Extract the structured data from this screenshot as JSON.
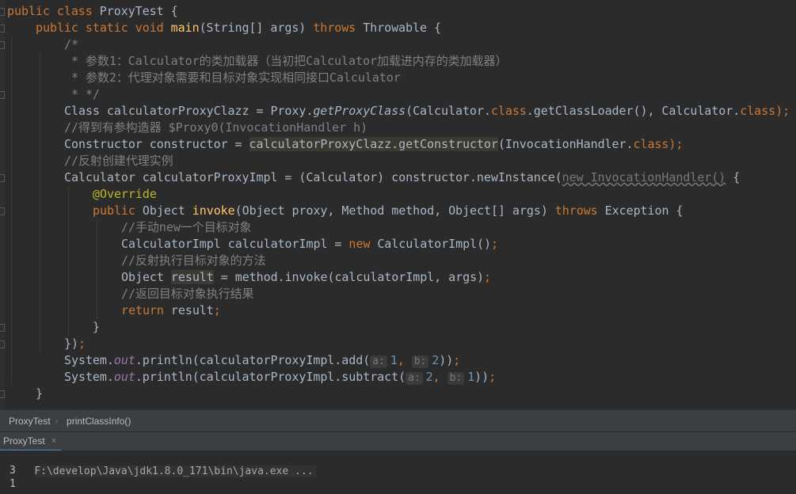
{
  "editor": {
    "lines": [
      {
        "indent": 0,
        "tokens": [
          {
            "t": "public class ",
            "c": "kw"
          },
          {
            "t": "ProxyTest {",
            "c": ""
          }
        ]
      },
      {
        "indent": 1,
        "tokens": [
          {
            "t": "public static void ",
            "c": "kw"
          },
          {
            "t": "main",
            "c": "fn"
          },
          {
            "t": "(String[] args) ",
            "c": ""
          },
          {
            "t": "throws ",
            "c": "kw"
          },
          {
            "t": "Throwable {",
            "c": ""
          }
        ]
      },
      {
        "indent": 2,
        "tokens": [
          {
            "t": "/*",
            "c": "cm"
          }
        ]
      },
      {
        "indent": 2,
        "tokens": [
          {
            "t": " * 参数1：Calculator的类加载器（当初把Calculator加载进内存的类加载器）",
            "c": "cm"
          }
        ]
      },
      {
        "indent": 2,
        "tokens": [
          {
            "t": " * 参数2：代理对象需要和目标对象实现相同接口Calculator",
            "c": "cm"
          }
        ]
      },
      {
        "indent": 2,
        "tokens": [
          {
            "t": " * */",
            "c": "cm"
          }
        ]
      },
      {
        "indent": 2,
        "tokens": [
          {
            "t": "Class calculatorProxyClazz = Proxy.",
            "c": ""
          },
          {
            "t": "getProxyClass",
            "c": "it"
          },
          {
            "t": "(Calculator.",
            "c": ""
          },
          {
            "t": "class",
            "c": "kw"
          },
          {
            "t": ".getClassLoader(), Calculator.",
            "c": ""
          },
          {
            "t": "class",
            "c": "kw"
          },
          {
            "t": ");",
            "c": "kw"
          }
        ]
      },
      {
        "indent": 2,
        "tokens": [
          {
            "t": "//得到有参构造器 $Proxy0(InvocationHandler h)",
            "c": "cm"
          }
        ]
      },
      {
        "indent": 2,
        "tokens": [
          {
            "t": "Constructor constructor = ",
            "c": ""
          },
          {
            "t": "calculatorProxyClazz.getConstructor",
            "c": "hl"
          },
          {
            "t": "(InvocationHandler.",
            "c": ""
          },
          {
            "t": "class",
            "c": "kw"
          },
          {
            "t": ");",
            "c": "kw"
          }
        ]
      },
      {
        "indent": 2,
        "tokens": [
          {
            "t": "//反射创建代理实例",
            "c": "cm"
          }
        ]
      },
      {
        "indent": 2,
        "tokens": [
          {
            "t": "Calculator calculatorProxyImpl = (Calculator) constructor.newInstance(",
            "c": ""
          },
          {
            "t": "new InvocationHandler()",
            "c": "squig"
          },
          {
            "t": " {",
            "c": ""
          }
        ]
      },
      {
        "indent": 3,
        "tokens": [
          {
            "t": "@Override",
            "c": "ann"
          }
        ]
      },
      {
        "indent": 3,
        "tokens": [
          {
            "t": "public ",
            "c": "kw"
          },
          {
            "t": "Object ",
            "c": ""
          },
          {
            "t": "invoke",
            "c": "fn"
          },
          {
            "t": "(Object proxy, Method method, Object[] args) ",
            "c": ""
          },
          {
            "t": "throws ",
            "c": "kw"
          },
          {
            "t": "Exception {",
            "c": ""
          }
        ]
      },
      {
        "indent": 4,
        "tokens": [
          {
            "t": "//手动new一个目标对象",
            "c": "cm"
          }
        ]
      },
      {
        "indent": 4,
        "tokens": [
          {
            "t": "CalculatorImpl calculatorImpl = ",
            "c": ""
          },
          {
            "t": "new ",
            "c": "kw"
          },
          {
            "t": "CalculatorImpl()",
            "c": ""
          },
          {
            "t": ";",
            "c": "kw"
          }
        ]
      },
      {
        "indent": 4,
        "tokens": [
          {
            "t": "//反射执行目标对象的方法",
            "c": "cm"
          }
        ]
      },
      {
        "indent": 4,
        "tokens": [
          {
            "t": "Object ",
            "c": ""
          },
          {
            "t": "result",
            "c": "hl2"
          },
          {
            "t": " = method.invoke(calculatorImpl, args)",
            "c": ""
          },
          {
            "t": ";",
            "c": "kw"
          }
        ]
      },
      {
        "indent": 4,
        "tokens": [
          {
            "t": "//返回目标对象执行结果",
            "c": "cm"
          }
        ]
      },
      {
        "indent": 4,
        "tokens": [
          {
            "t": "return ",
            "c": "kw"
          },
          {
            "t": "result",
            "c": ""
          },
          {
            "t": ";",
            "c": "kw"
          }
        ]
      },
      {
        "indent": 3,
        "tokens": [
          {
            "t": "}",
            "c": ""
          }
        ]
      },
      {
        "indent": 2,
        "tokens": [
          {
            "t": "})",
            "c": ""
          },
          {
            "t": ";",
            "c": "kw"
          }
        ]
      },
      {
        "indent": 2,
        "tokens": [
          {
            "t": "System.",
            "c": ""
          },
          {
            "t": "out",
            "c": "st"
          },
          {
            "t": ".println(calculatorProxyImpl.add(",
            "c": ""
          },
          {
            "t": "a:",
            "c": "hint"
          },
          {
            "t": "1",
            "c": "num"
          },
          {
            "t": ", ",
            "c": "kw"
          },
          {
            "t": "b:",
            "c": "hint"
          },
          {
            "t": "2",
            "c": "num"
          },
          {
            "t": "))",
            "c": ""
          },
          {
            "t": ";",
            "c": "kw"
          }
        ]
      },
      {
        "indent": 2,
        "tokens": [
          {
            "t": "System.",
            "c": ""
          },
          {
            "t": "out",
            "c": "st"
          },
          {
            "t": ".println(calculatorProxyImpl.subtract(",
            "c": ""
          },
          {
            "t": "a:",
            "c": "hint"
          },
          {
            "t": "2",
            "c": "num"
          },
          {
            "t": ", ",
            "c": "kw"
          },
          {
            "t": "b:",
            "c": "hint"
          },
          {
            "t": "1",
            "c": "num"
          },
          {
            "t": "))",
            "c": ""
          },
          {
            "t": ";",
            "c": "kw"
          }
        ]
      },
      {
        "indent": 1,
        "tokens": [
          {
            "t": "}",
            "c": ""
          }
        ]
      }
    ]
  },
  "breadcrumb": {
    "class_name": "ProxyTest",
    "method_name": "printClassInfo()"
  },
  "run_panel": {
    "tab_label": "ProxyTest",
    "close_glyph": "×",
    "command": "F:\\develop\\Java\\jdk1.8.0_171\\bin\\java.exe ...",
    "output": [
      "3",
      "1"
    ]
  },
  "colors": {
    "background": "#2b2b2b",
    "keyword": "#cc7832",
    "function": "#ffc66d",
    "comment": "#808080",
    "number": "#6897bb",
    "annotation": "#bbb529",
    "static_field": "#9876aa"
  }
}
